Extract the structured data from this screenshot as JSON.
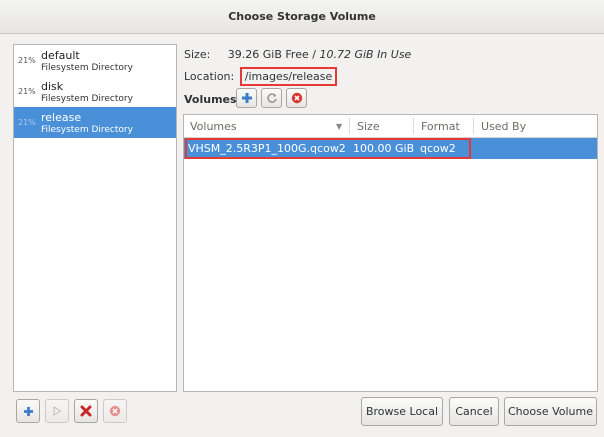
{
  "window": {
    "title": "Choose Storage Volume"
  },
  "pools": [
    {
      "pct": "21%",
      "name": "default",
      "type": "Filesystem Directory",
      "selected": false
    },
    {
      "pct": "21%",
      "name": "disk",
      "type": "Filesystem Directory",
      "selected": false
    },
    {
      "pct": "21%",
      "name": "release",
      "type": "Filesystem Directory",
      "selected": true
    }
  ],
  "pool_info": {
    "size_label": "Size:",
    "size_free": "39.26 GiB Free /",
    "size_used": "10.72 GiB In Use",
    "location_label": "Location:",
    "location_value": "/images/release"
  },
  "volumes_toolbar": {
    "label": "Volumes"
  },
  "table": {
    "columns": [
      "Volumes",
      "Size",
      "Format",
      "Used By"
    ],
    "rows": [
      {
        "name": "VHSM_2.5R3P1_100G.qcow2",
        "size": "100.00 GiB",
        "format": "qcow2",
        "used_by": ""
      }
    ]
  },
  "buttons": {
    "browse_local": "Browse Local",
    "cancel": "Cancel",
    "choose_volume": "Choose Volume"
  },
  "colors": {
    "selection": "#4a90d9",
    "highlight": "#e53935"
  }
}
